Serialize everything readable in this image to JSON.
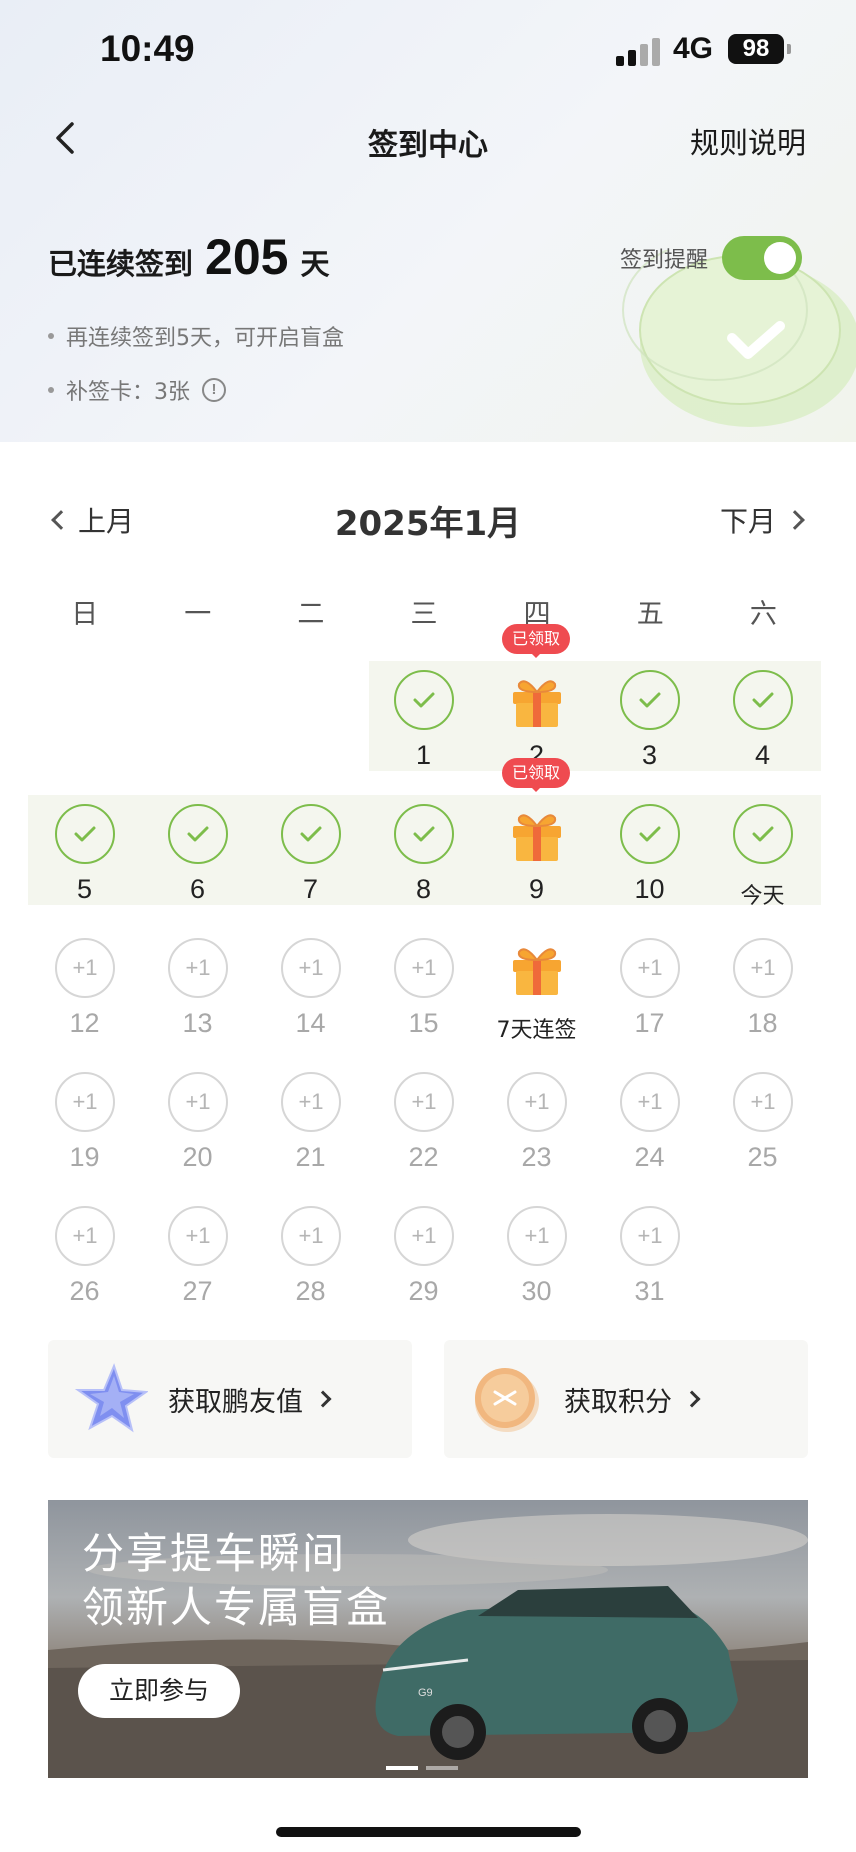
{
  "status_bar": {
    "time": "10:49",
    "network": "4G",
    "battery": "98"
  },
  "nav": {
    "title": "签到中心",
    "rules_link": "规则说明"
  },
  "streak": {
    "prefix": "已连续签到",
    "days": "205",
    "unit": "天"
  },
  "reminder": {
    "label": "签到提醒",
    "enabled": true
  },
  "notes": {
    "blind_box": "再连续签到5天，可开启盲盒",
    "makeup_prefix": "补签卡：",
    "makeup_count": "3张"
  },
  "calendar": {
    "prev_label": "上月",
    "month_title": "2025年1月",
    "next_label": "下月",
    "weekdays": [
      "日",
      "一",
      "二",
      "三",
      "四",
      "五",
      "六"
    ],
    "claimed_badge": "已领取",
    "plus_label": "+1",
    "days": [
      {
        "label": "1"
      },
      {
        "label": "2"
      },
      {
        "label": "3"
      },
      {
        "label": "4"
      },
      {
        "label": "5"
      },
      {
        "label": "6"
      },
      {
        "label": "7"
      },
      {
        "label": "8"
      },
      {
        "label": "9"
      },
      {
        "label": "10"
      },
      {
        "label": "今天"
      },
      {
        "label": "12"
      },
      {
        "label": "13"
      },
      {
        "label": "14"
      },
      {
        "label": "15"
      },
      {
        "label": "7天连签"
      },
      {
        "label": "17"
      },
      {
        "label": "18"
      },
      {
        "label": "19"
      },
      {
        "label": "20"
      },
      {
        "label": "21"
      },
      {
        "label": "22"
      },
      {
        "label": "23"
      },
      {
        "label": "24"
      },
      {
        "label": "25"
      },
      {
        "label": "26"
      },
      {
        "label": "27"
      },
      {
        "label": "28"
      },
      {
        "label": "29"
      },
      {
        "label": "30"
      },
      {
        "label": "31"
      }
    ]
  },
  "quick_links": {
    "friend_value": "获取鹏友值",
    "points": "获取积分"
  },
  "banner": {
    "line1": "分享提车瞬间",
    "line2": "领新人专属盲盒",
    "button": "立即参与",
    "car_badge": "G9"
  },
  "colors": {
    "accent_green": "#7dbd4b",
    "badge_red": "#ef4b50",
    "gift_orange": "#f7a531"
  }
}
